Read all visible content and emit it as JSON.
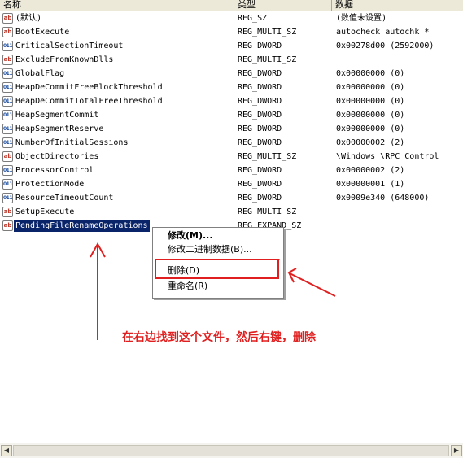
{
  "header": {
    "name": "名称",
    "type": "类型",
    "data": "数据"
  },
  "rows": [
    {
      "name": "(默认)",
      "type": "REG_SZ",
      "data": "(数值未设置)",
      "icon": "ab"
    },
    {
      "name": "BootExecute",
      "type": "REG_MULTI_SZ",
      "data": "autocheck autochk *",
      "icon": "ab"
    },
    {
      "name": "CriticalSectionTimeout",
      "type": "REG_DWORD",
      "data": "0x00278d00 (2592000)",
      "icon": "bin"
    },
    {
      "name": "ExcludeFromKnownDlls",
      "type": "REG_MULTI_SZ",
      "data": "",
      "icon": "ab"
    },
    {
      "name": "GlobalFlag",
      "type": "REG_DWORD",
      "data": "0x00000000 (0)",
      "icon": "bin"
    },
    {
      "name": "HeapDeCommitFreeBlockThreshold",
      "type": "REG_DWORD",
      "data": "0x00000000 (0)",
      "icon": "bin"
    },
    {
      "name": "HeapDeCommitTotalFreeThreshold",
      "type": "REG_DWORD",
      "data": "0x00000000 (0)",
      "icon": "bin"
    },
    {
      "name": "HeapSegmentCommit",
      "type": "REG_DWORD",
      "data": "0x00000000 (0)",
      "icon": "bin"
    },
    {
      "name": "HeapSegmentReserve",
      "type": "REG_DWORD",
      "data": "0x00000000 (0)",
      "icon": "bin"
    },
    {
      "name": "NumberOfInitialSessions",
      "type": "REG_DWORD",
      "data": "0x00000002 (2)",
      "icon": "bin"
    },
    {
      "name": "ObjectDirectories",
      "type": "REG_MULTI_SZ",
      "data": "\\Windows \\RPC Control",
      "icon": "ab"
    },
    {
      "name": "ProcessorControl",
      "type": "REG_DWORD",
      "data": "0x00000002 (2)",
      "icon": "bin"
    },
    {
      "name": "ProtectionMode",
      "type": "REG_DWORD",
      "data": "0x00000001 (1)",
      "icon": "bin"
    },
    {
      "name": "ResourceTimeoutCount",
      "type": "REG_DWORD",
      "data": "0x0009e340 (648000)",
      "icon": "bin"
    },
    {
      "name": "SetupExecute",
      "type": "REG_MULTI_SZ",
      "data": "",
      "icon": "ab"
    },
    {
      "name": "PendingFileRenameOperations",
      "type": "REG_EXPAND_SZ",
      "data": "",
      "icon": "ab",
      "selected": true
    }
  ],
  "context_menu": {
    "modify": "修改(M)...",
    "modify_binary": "修改二进制数据(B)...",
    "delete": "删除(D)",
    "rename": "重命名(R)"
  },
  "annotation": "在右边找到这个文件，然后右键，删除",
  "colors": {
    "accent": "#e02020",
    "selection": "#0a246a"
  }
}
